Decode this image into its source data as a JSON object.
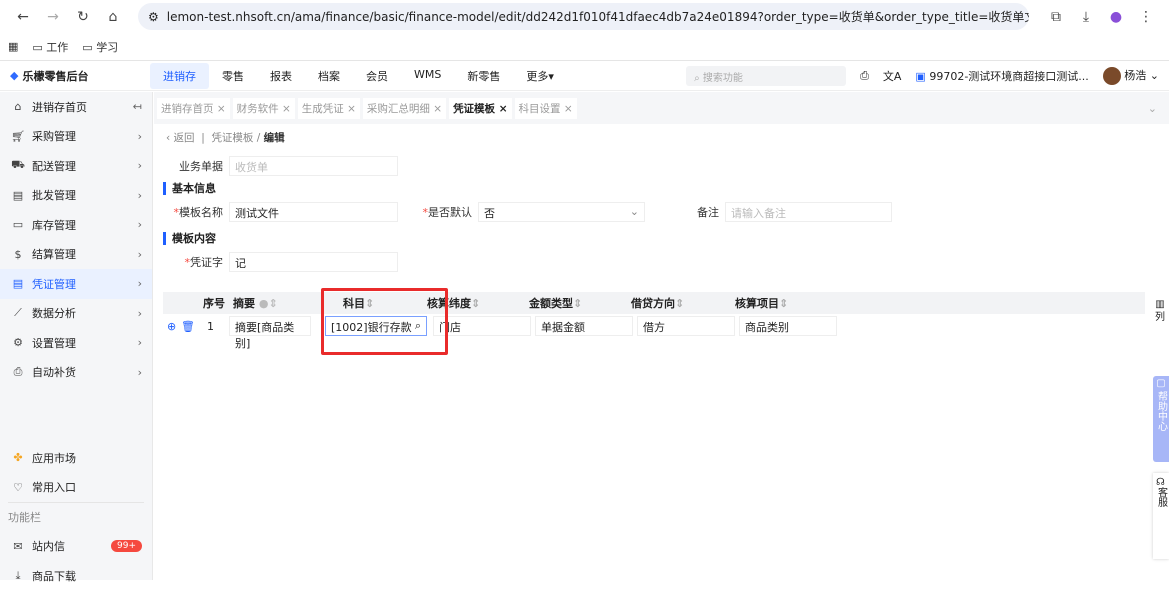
{
  "browser": {
    "url": "lemon-test.nhsoft.cn/ama/finance/basic/finance-model/edit/dd242d1f010f41dfaec4db7a24e01894?order_type=收货单&order_type_title=收货单",
    "bookmarks": [
      "工作",
      "学习"
    ]
  },
  "app": {
    "title": "乐檬零售后台",
    "menu": [
      "进销存",
      "零售",
      "报表",
      "档案",
      "会员",
      "WMS",
      "新零售",
      "更多▾"
    ],
    "search_placeholder": "搜索功能",
    "store": "99702-测试环境商超接口测试...",
    "user": "杨浩"
  },
  "sidebar": {
    "items": [
      "进销存首页",
      "采购管理",
      "配送管理",
      "批发管理",
      "库存管理",
      "结算管理",
      "凭证管理",
      "数据分析",
      "设置管理",
      "自动补货"
    ],
    "bottom": [
      "应用市场",
      "常用入口"
    ],
    "section": "功能栏",
    "mail": "站内信",
    "mail_badge": "99+",
    "last": "商品下载"
  },
  "tabs": [
    "进销存首页 ×",
    "财务软件 ×",
    "生成凭证 ×",
    "采购汇总明细 ×",
    "凭证模板 ×",
    "科目设置 ×"
  ],
  "breadcrumb": {
    "back": "返回",
    "parent": "凭证模板",
    "current": "编辑"
  },
  "form": {
    "doc_label": "业务单据",
    "doc_value": "收货单",
    "basic": "基本信息",
    "name_label": "模板名称",
    "name_value": "测试文件",
    "default_label": "是否默认",
    "default_value": "否",
    "remark_label": "备注",
    "remark_placeholder": "请输入备注",
    "content": "模板内容",
    "voucher_label": "凭证字",
    "voucher_value": "记"
  },
  "table": {
    "headers": [
      "序号",
      "摘要",
      "科目",
      "核算纬度",
      "金额类型",
      "借贷方向",
      "核算项目"
    ],
    "row": {
      "no": "1",
      "summary": "摘要[商品类别]",
      "subject": "[1002]银行存款",
      "dim": "门店",
      "amount": "单据金额",
      "direction": "借方",
      "item": "商品类别"
    },
    "columns_btn": "列"
  },
  "float": {
    "help": "帮助中心",
    "service": "客服"
  }
}
